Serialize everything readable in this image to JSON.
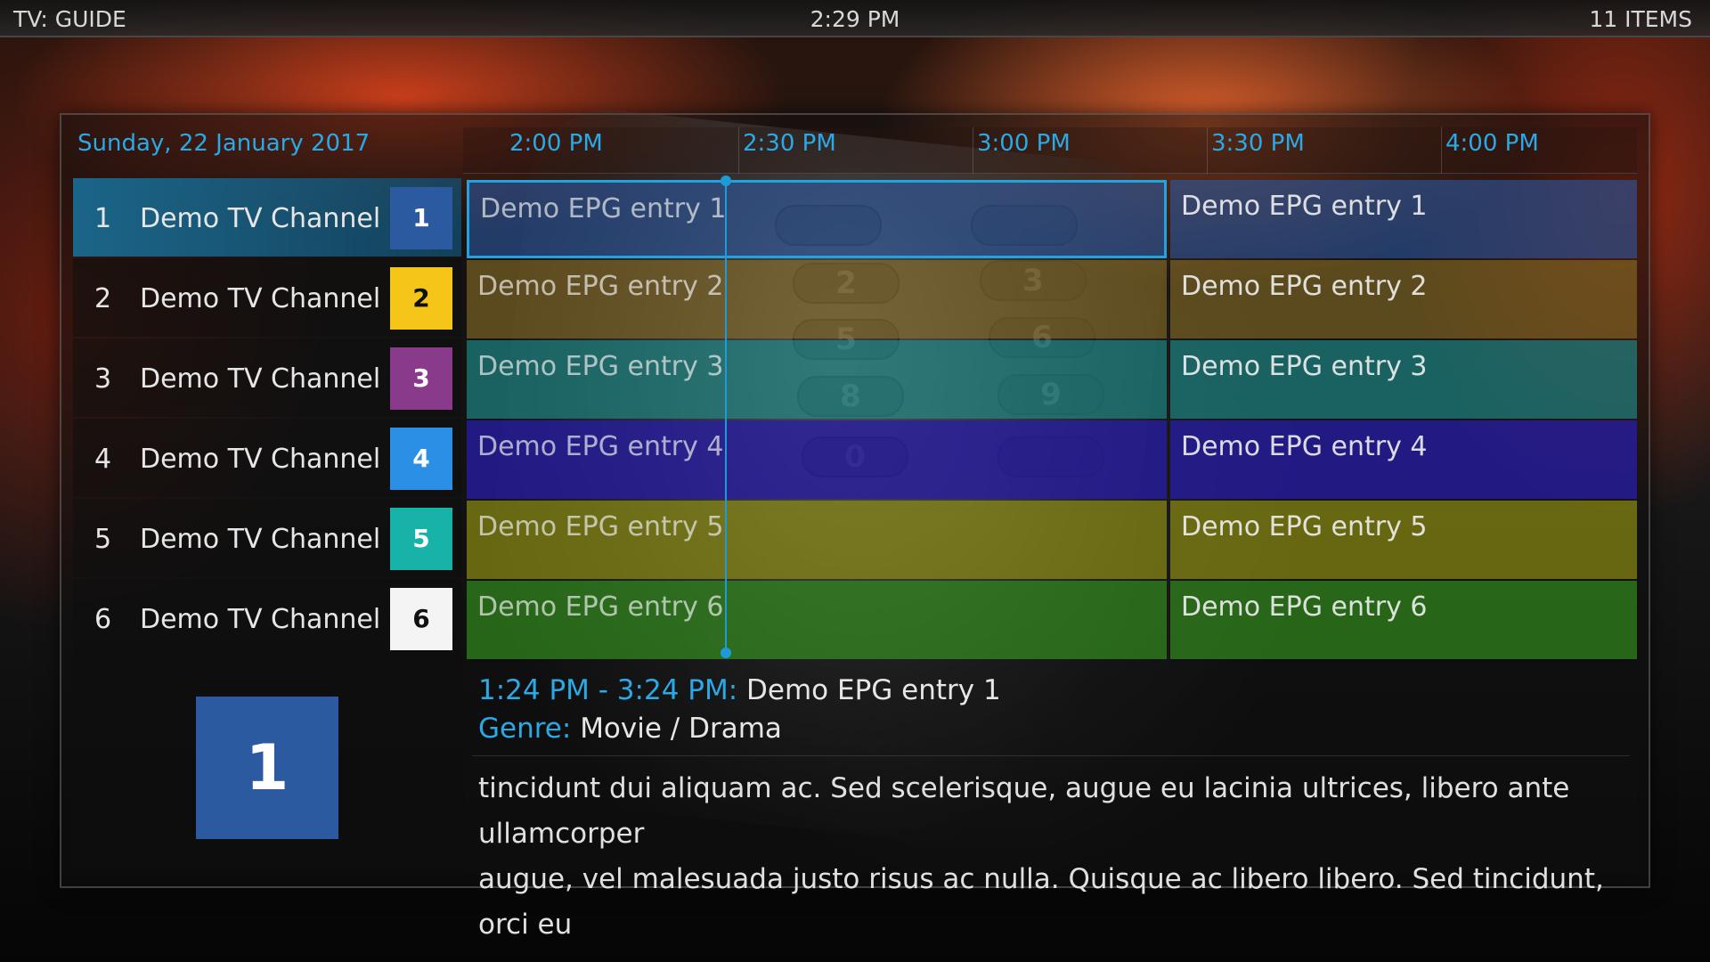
{
  "header": {
    "title": "TV: GUIDE",
    "clock": "2:29 PM",
    "item_count": "11 ITEMS"
  },
  "guide": {
    "date": "Sunday, 22 January 2017",
    "timeline": [
      "2:00 PM",
      "2:30 PM",
      "3:00 PM",
      "3:30 PM",
      "4:00 PM"
    ],
    "channels": [
      {
        "number": "1",
        "name": "Demo TV Channel 1",
        "logo": "1",
        "logo_color": "#2c5aa0",
        "logo_text_color": "#ffffff"
      },
      {
        "number": "2",
        "name": "Demo TV Channel 2",
        "logo": "2",
        "logo_color": "#f5c518",
        "logo_text_color": "#111111"
      },
      {
        "number": "3",
        "name": "Demo TV Channel 3",
        "logo": "3",
        "logo_color": "#8a3a8a",
        "logo_text_color": "#ffffff"
      },
      {
        "number": "4",
        "name": "Demo TV Channel 4",
        "logo": "4",
        "logo_color": "#2b8fe6",
        "logo_text_color": "#ffffff"
      },
      {
        "number": "5",
        "name": "Demo TV Channel 5",
        "logo": "5",
        "logo_color": "#17b3a8",
        "logo_text_color": "#ffffff"
      },
      {
        "number": "6",
        "name": "Demo TV Channel 6",
        "logo": "6",
        "logo_color": "#f4f4f4",
        "logo_text_color": "#111111"
      }
    ],
    "rows": [
      {
        "color": "rgba(45,95,175,0.55)",
        "entries": [
          {
            "title": "Demo EPG entry 1"
          },
          {
            "title": "Demo EPG entry 1"
          }
        ]
      },
      {
        "color": "rgba(150,120,40,0.55)",
        "entries": [
          {
            "title": "Demo EPG entry 2"
          },
          {
            "title": "Demo EPG entry 2"
          }
        ]
      },
      {
        "color": "rgba(30,150,150,0.6)",
        "entries": [
          {
            "title": "Demo EPG entry 3"
          },
          {
            "title": "Demo EPG entry 3"
          }
        ]
      },
      {
        "color": "rgba(40,30,170,0.75)",
        "entries": [
          {
            "title": "Demo EPG entry 4"
          },
          {
            "title": "Demo EPG entry 4"
          }
        ]
      },
      {
        "color": "rgba(150,150,20,0.65)",
        "entries": [
          {
            "title": "Demo EPG entry 5"
          },
          {
            "title": "Demo EPG entry 5"
          }
        ]
      },
      {
        "color": "rgba(50,140,30,0.7)",
        "entries": [
          {
            "title": "Demo EPG entry 6"
          },
          {
            "title": "Demo EPG entry 6"
          }
        ]
      }
    ]
  },
  "info": {
    "channel_logo": "1",
    "time_range": "1:24 PM - 3:24 PM:",
    "title": "Demo EPG entry 1",
    "genre_label": "Genre:",
    "genre": "Movie / Drama",
    "plot_line1": "tincidunt dui aliquam ac. Sed scelerisque, augue eu lacinia ultrices, libero ante ullamcorper",
    "plot_line2": "augue, vel malesuada justo risus ac nulla. Quisque ac libero libero. Sed tincidunt, orci eu"
  },
  "colors": {
    "accent": "#2aa9e6",
    "focus_border": "#21a3e0"
  }
}
